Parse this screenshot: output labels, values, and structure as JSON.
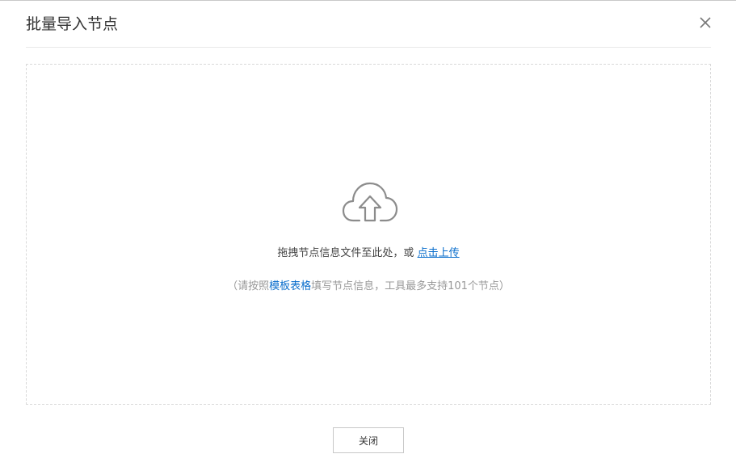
{
  "dialog": {
    "title": "批量导入节点",
    "close_icon": "close-icon"
  },
  "upload": {
    "icon": "cloud-upload-icon",
    "main_text": "拖拽节点信息文件至此处，或 ",
    "link_text": "点击上传",
    "hint_prefix": "（请按照",
    "hint_link": "模板表格",
    "hint_suffix": "填写节点信息，工具最多支持101个节点）"
  },
  "footer": {
    "close_label": "关闭"
  },
  "colors": {
    "link": "#0a6ecc",
    "border": "#d9d9d9",
    "icon": "#8c8c8c"
  }
}
